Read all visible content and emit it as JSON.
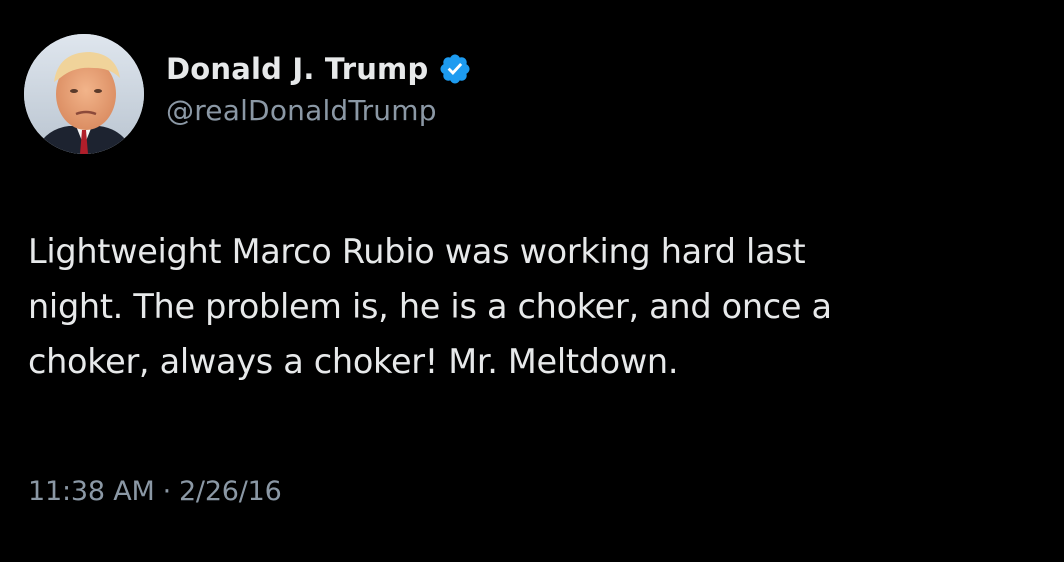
{
  "author": {
    "display_name": "Donald J. Trump",
    "handle": "@realDonaldTrump",
    "verified_icon": "verified-badge-icon",
    "badge_color": "#1d9bf0"
  },
  "tweet": {
    "text_lines": [
      "Lightweight Marco Rubio was working hard last",
      "night. The problem is, he is a choker, and once a",
      "choker, always a choker! Mr. Meltdown."
    ],
    "time": "11:38 AM",
    "separator": "·",
    "date": "2/26/16"
  },
  "colors": {
    "background": "#000000",
    "text": "#e7e9ea",
    "secondary_text": "#8b98a5"
  }
}
